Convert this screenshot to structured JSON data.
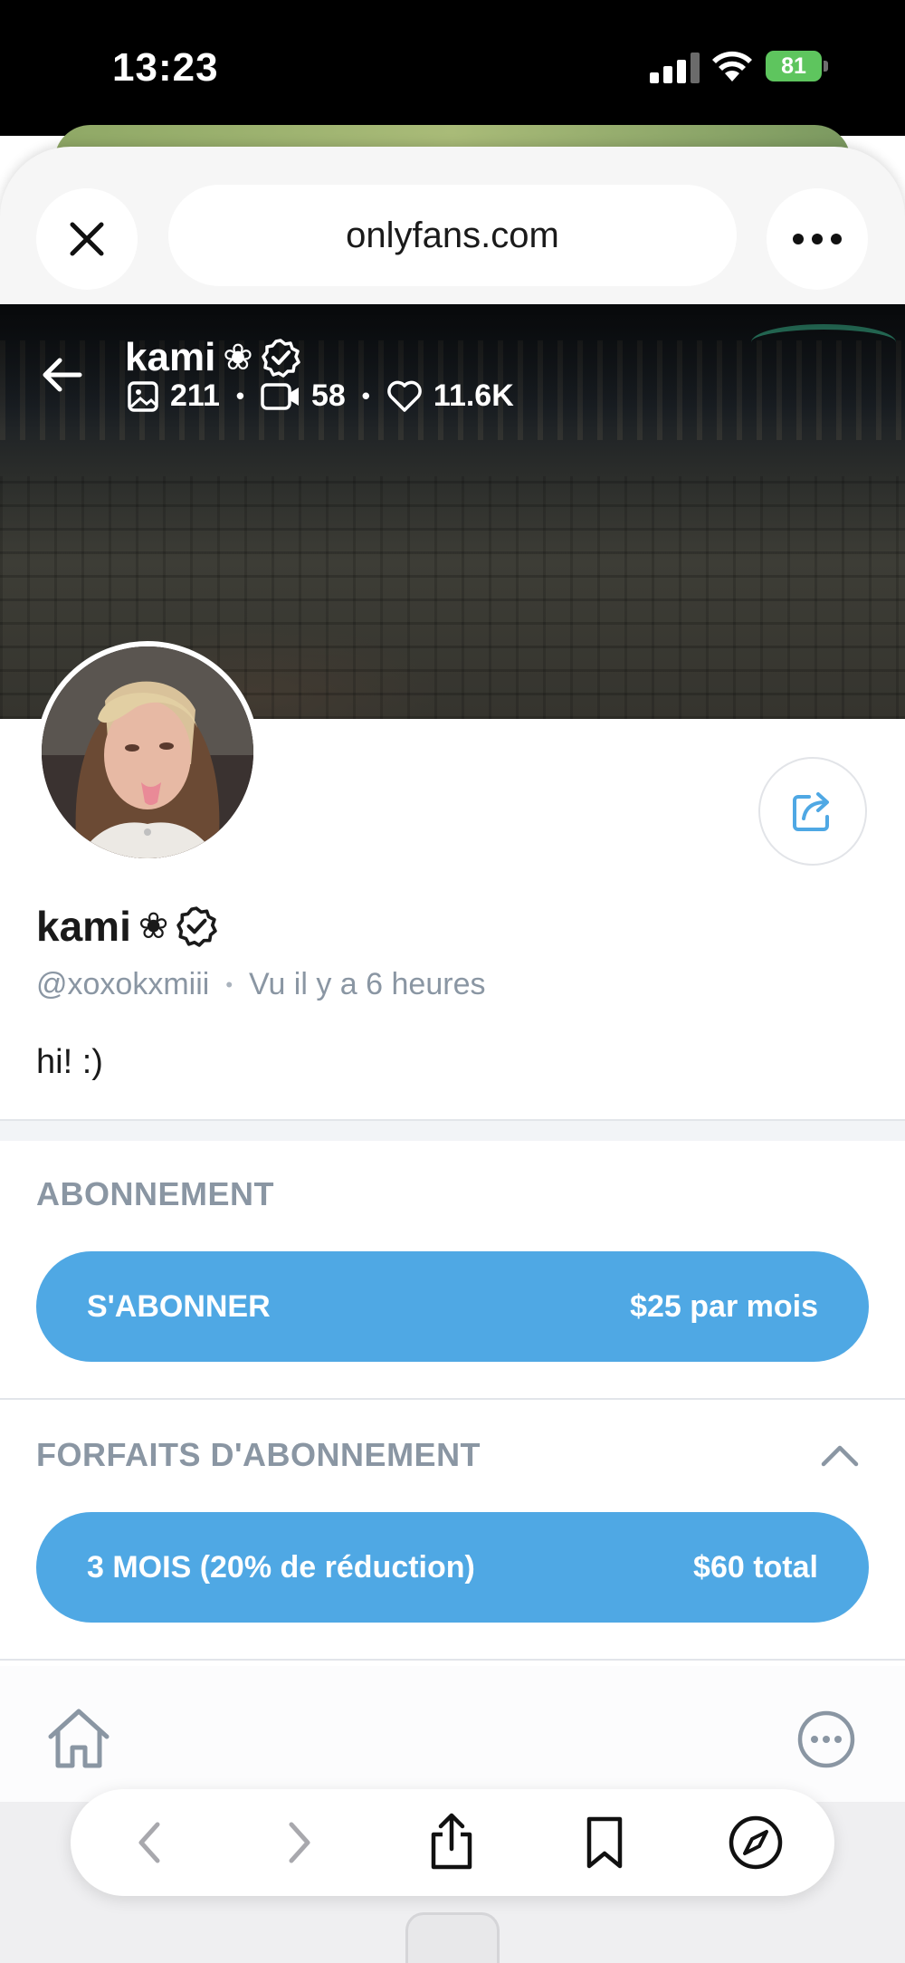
{
  "status_bar": {
    "time": "13:23",
    "battery": "81"
  },
  "browser": {
    "url": "onlyfans.com"
  },
  "cover": {
    "name": "kami",
    "flower": "❀",
    "stats": {
      "photos": "211",
      "videos": "58",
      "likes": "11.6K"
    }
  },
  "profile": {
    "name": "kami",
    "flower": "❀",
    "handle": "@xoxokxmiii",
    "separator": "•",
    "last_seen": "Vu  il y a 6 heures",
    "bio": "hi! :)"
  },
  "subscription": {
    "title": "ABONNEMENT",
    "button_label": "S'ABONNER",
    "button_price": "$25 par mois"
  },
  "bundles": {
    "title": "FORFAITS D'ABONNEMENT",
    "items": [
      {
        "label": "3 MOIS (20% de réduction)",
        "price": "$60 total"
      }
    ]
  },
  "colors": {
    "accent": "#4fa8e4",
    "muted_text": "#8a96a3"
  },
  "icons": [
    "close-icon",
    "more-horizontal-icon",
    "back-arrow-icon",
    "flower-icon",
    "verified-icon",
    "image-icon",
    "video-icon",
    "heart-icon",
    "share-icon",
    "chevron-up-icon",
    "home-icon",
    "more-circle-icon",
    "nav-back-icon",
    "nav-forward-icon",
    "share-sheet-icon",
    "bookmarks-icon",
    "compass-icon"
  ]
}
